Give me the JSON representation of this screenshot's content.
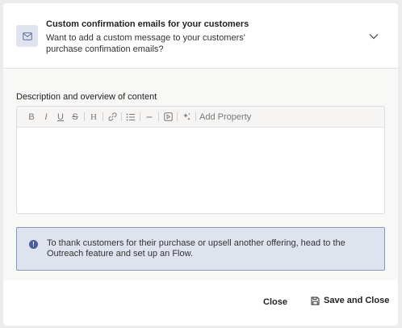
{
  "header": {
    "title": "Custom confirmation emails for your customers",
    "description": "Want to add a custom message to your customers' purchase confimation emails?"
  },
  "editor": {
    "label": "Description and overview of content",
    "toolbar": {
      "bold": "B",
      "italic": "I",
      "underline": "U",
      "strikethrough": "S",
      "heading": "H",
      "add_property": "Add Property"
    }
  },
  "info": {
    "icon_glyph": "!",
    "text": "To thank customers for their purchase or upsell another offering, head to the Outreach feature and set up an Flow."
  },
  "footer": {
    "close_label": "Close",
    "save_label": "Save and Close"
  },
  "colors": {
    "info_background": "#dfe3ee",
    "info_border": "#8c98b8",
    "info_icon": "#4a5f9a",
    "badge_background": "#dfe4ee"
  }
}
